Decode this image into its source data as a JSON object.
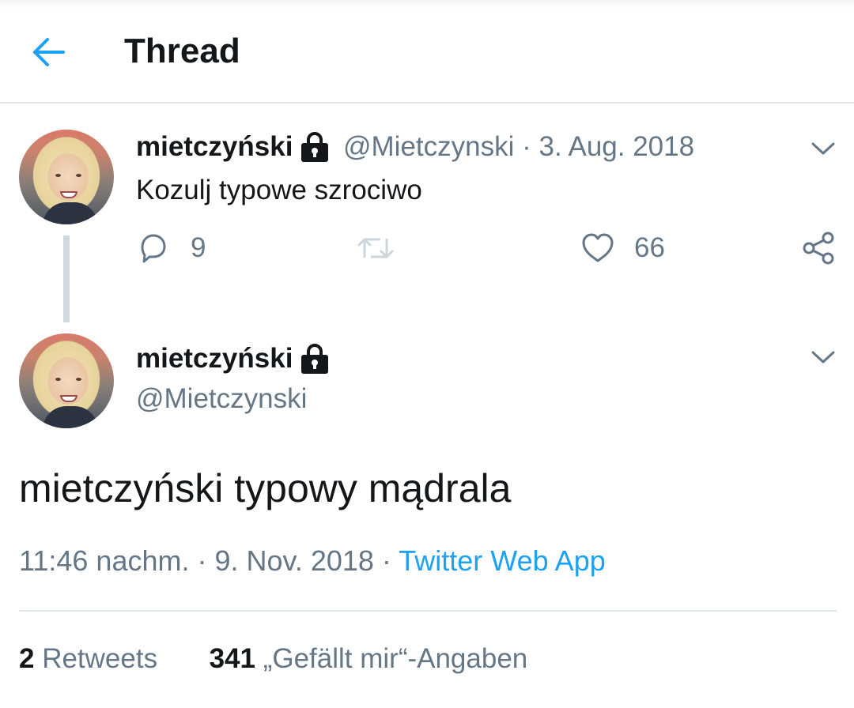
{
  "header": {
    "title": "Thread"
  },
  "tweet1": {
    "display_name": "mietczyński",
    "meta": "@Mietczynski · 3. Aug. 2018",
    "text": "Kozulj typowe szrociwo",
    "replies": "9",
    "likes": "66"
  },
  "tweet2": {
    "display_name": "mietczyński",
    "handle": "@Mietczynski",
    "text": "mietczyński typowy mądrala",
    "time": "11:46 nachm. · 9. Nov. 2018 · ",
    "source": "Twitter Web App",
    "retweets_count": "2",
    "retweets_label": " Retweets",
    "likes_count": "341",
    "likes_label": " „Gefällt mir“-Angaben"
  },
  "icons": {
    "back": "arrow-left-icon",
    "lock": "lock-icon",
    "menu": "chevron-down-icon",
    "reply": "reply-icon",
    "retweet": "retweet-icon",
    "like": "heart-icon",
    "share": "share-icon"
  },
  "colors": {
    "accent": "#1da1f2",
    "text": "#14171a",
    "secondary": "#657786",
    "divider": "#e1e8ed"
  }
}
